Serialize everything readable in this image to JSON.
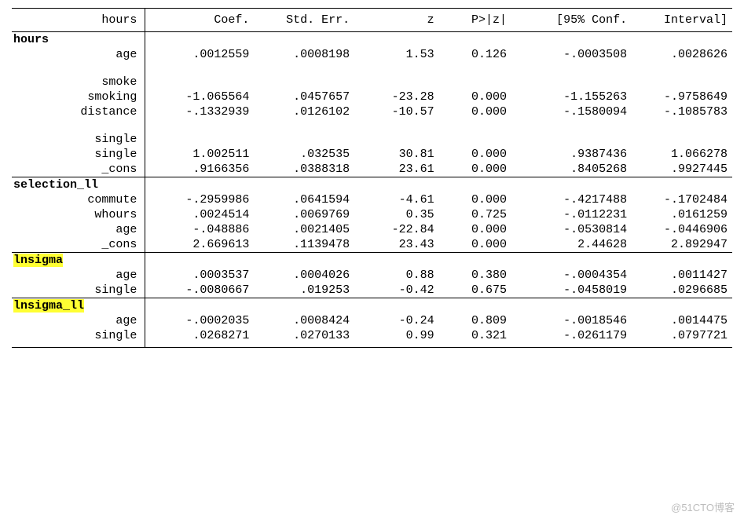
{
  "header": {
    "depvar": "hours",
    "cols": [
      "Coef.",
      "Std. Err.",
      "z",
      "P>|z|",
      "[95% Conf.",
      "Interval]"
    ]
  },
  "sections": [
    {
      "title": "hours",
      "highlight": false,
      "blocks": [
        {
          "subhead": null,
          "rows": [
            {
              "label": "age",
              "vals": [
                ".0012559",
                ".0008198",
                "1.53",
                "0.126",
                "-.0003508",
                ".0028626"
              ]
            }
          ]
        },
        {
          "subhead": "smoke",
          "rows": [
            {
              "label": "smoking",
              "vals": [
                "-1.065564",
                ".0457657",
                "-23.28",
                "0.000",
                "-1.155263",
                "-.9758649"
              ]
            },
            {
              "label": "distance",
              "vals": [
                "-.1332939",
                ".0126102",
                "-10.57",
                "0.000",
                "-.1580094",
                "-.1085783"
              ]
            }
          ]
        },
        {
          "subhead": "single",
          "rows": [
            {
              "label": "single",
              "vals": [
                "1.002511",
                ".032535",
                "30.81",
                "0.000",
                ".9387436",
                "1.066278"
              ]
            },
            {
              "label": "_cons",
              "vals": [
                ".9166356",
                ".0388318",
                "23.61",
                "0.000",
                ".8405268",
                ".9927445"
              ]
            }
          ]
        }
      ]
    },
    {
      "title": "selection_ll",
      "highlight": false,
      "blocks": [
        {
          "subhead": null,
          "rows": [
            {
              "label": "commute",
              "vals": [
                "-.2959986",
                ".0641594",
                "-4.61",
                "0.000",
                "-.4217488",
                "-.1702484"
              ]
            },
            {
              "label": "whours",
              "vals": [
                ".0024514",
                ".0069769",
                "0.35",
                "0.725",
                "-.0112231",
                ".0161259"
              ]
            },
            {
              "label": "age",
              "vals": [
                "-.048886",
                ".0021405",
                "-22.84",
                "0.000",
                "-.0530814",
                "-.0446906"
              ]
            },
            {
              "label": "_cons",
              "vals": [
                "2.669613",
                ".1139478",
                "23.43",
                "0.000",
                "2.44628",
                "2.892947"
              ]
            }
          ]
        }
      ]
    },
    {
      "title": "lnsigma",
      "highlight": true,
      "blocks": [
        {
          "subhead": null,
          "rows": [
            {
              "label": "age",
              "vals": [
                ".0003537",
                ".0004026",
                "0.88",
                "0.380",
                "-.0004354",
                ".0011427"
              ]
            },
            {
              "label": "single",
              "vals": [
                "-.0080667",
                ".019253",
                "-0.42",
                "0.675",
                "-.0458019",
                ".0296685"
              ]
            }
          ]
        }
      ]
    },
    {
      "title": "lnsigma_ll",
      "highlight": true,
      "blocks": [
        {
          "subhead": null,
          "rows": [
            {
              "label": "age",
              "vals": [
                "-.0002035",
                ".0008424",
                "-0.24",
                "0.809",
                "-.0018546",
                ".0014475"
              ]
            },
            {
              "label": "single",
              "vals": [
                ".0268271",
                ".0270133",
                "0.99",
                "0.321",
                "-.0261179",
                ".0797721"
              ]
            }
          ]
        }
      ]
    }
  ],
  "watermark": "@51CTO博客"
}
